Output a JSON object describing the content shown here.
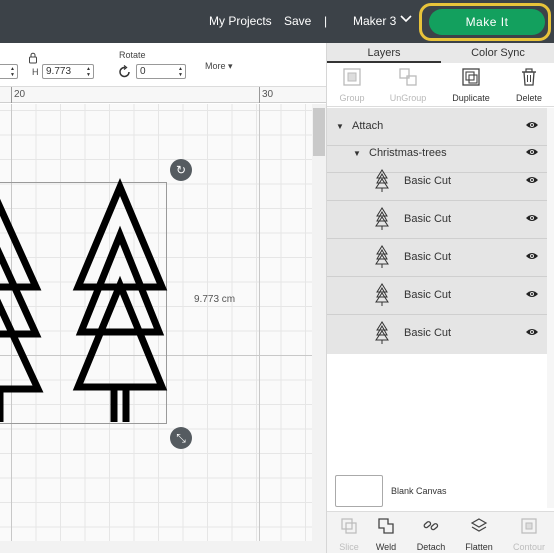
{
  "topbar": {
    "my_projects": "My Projects",
    "save": "Save",
    "separator": "|",
    "machine": "Maker 3",
    "make_it": "Make It"
  },
  "edit_toolbar": {
    "w_value": "",
    "h_label": "H",
    "h_value": "9.773",
    "rotate_label": "Rotate",
    "rotate_value": "0",
    "more": "More"
  },
  "ruler": {
    "labels": [
      "20",
      "30"
    ]
  },
  "canvas": {
    "dimension_label": "9.773 cm",
    "colors": {
      "grid": "#e6e6e6",
      "selection": "#9a9a9a",
      "handle": "#555b60"
    }
  },
  "panel": {
    "tabs": [
      "Layers",
      "Color Sync"
    ],
    "tools": [
      {
        "label": "Group",
        "enabled": false,
        "icon": "group-icon"
      },
      {
        "label": "UnGroup",
        "enabled": false,
        "icon": "ungroup-icon"
      },
      {
        "label": "Duplicate",
        "enabled": true,
        "icon": "duplicate-icon"
      },
      {
        "label": "Delete",
        "enabled": true,
        "icon": "trash-icon"
      }
    ],
    "layers": {
      "attach": "Attach",
      "group": "Christmas-trees",
      "items": [
        "Basic Cut",
        "Basic Cut",
        "Basic Cut",
        "Basic Cut",
        "Basic Cut"
      ]
    },
    "canvas_label": "Blank Canvas",
    "bottom_tools": [
      {
        "label": "Slice",
        "enabled": false,
        "icon": "slice-icon"
      },
      {
        "label": "Weld",
        "enabled": true,
        "icon": "weld-icon"
      },
      {
        "label": "Detach",
        "enabled": true,
        "icon": "detach-icon"
      },
      {
        "label": "Flatten",
        "enabled": true,
        "icon": "flatten-icon"
      },
      {
        "label": "Contour",
        "enabled": false,
        "icon": "contour-icon"
      }
    ]
  },
  "colors": {
    "topbar": "#3c4248",
    "make_it": "#13a05e",
    "highlight_ring": "#e8c33a",
    "layers_bg": "#e5e5e5"
  }
}
